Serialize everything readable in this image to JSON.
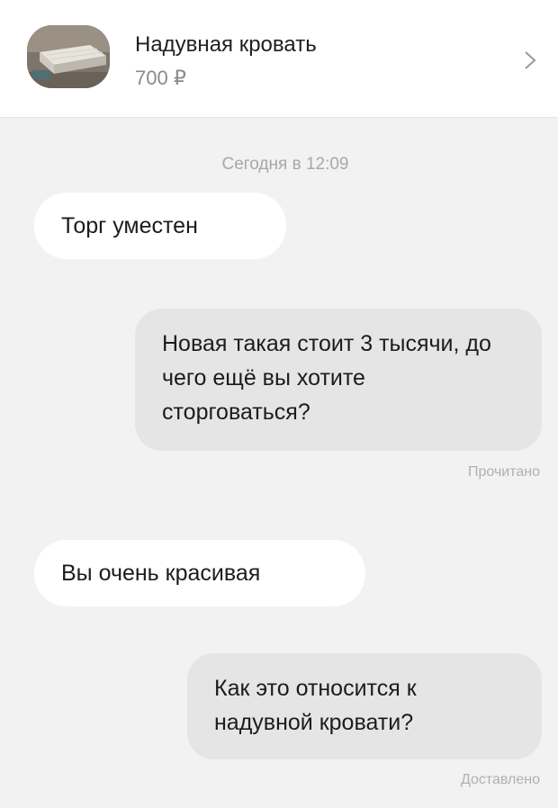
{
  "listing": {
    "title": "Надувная кровать",
    "price": "700 ₽",
    "thumbnail_icon": "air-mattress-photo",
    "chevron_icon": "chevron-right-icon"
  },
  "chat": {
    "timestamp": "Сегодня в 12:09",
    "messages": [
      {
        "direction": "incoming",
        "text": "Торг уместен"
      },
      {
        "direction": "outgoing",
        "text": "Новая такая стоит 3 тысячи, до чего ещё вы хотите сторговаться?",
        "status": "Прочитано"
      },
      {
        "direction": "incoming",
        "text": "Вы очень красивая"
      },
      {
        "direction": "outgoing",
        "text": "Как это относится к надувной кровати?",
        "status": "Доставлено"
      }
    ]
  },
  "colors": {
    "background": "#f2f2f2",
    "incoming_bubble": "#ffffff",
    "outgoing_bubble": "#e5e5e5",
    "secondary_text": "#a8a8a8"
  }
}
